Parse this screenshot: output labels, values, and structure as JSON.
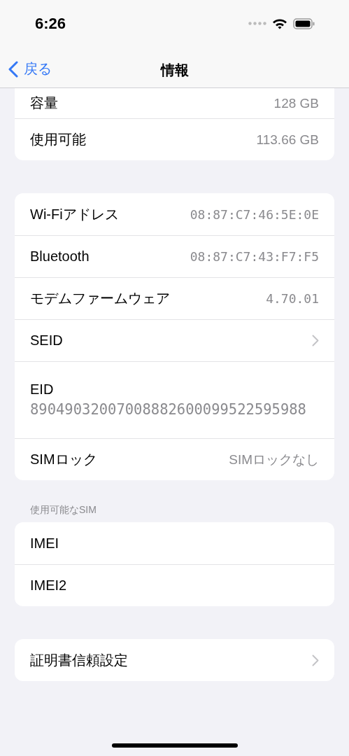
{
  "status_bar": {
    "time": "6:26"
  },
  "nav": {
    "back": "戻る",
    "title": "情報"
  },
  "groups": [
    {
      "clipped_top": true,
      "rows": [
        {
          "kind": "value",
          "label": "容量",
          "value": "128 GB",
          "mono": false
        },
        {
          "kind": "value",
          "label": "使用可能",
          "value": "113.66 GB",
          "mono": false
        }
      ]
    },
    {
      "clipped_top": false,
      "rows": [
        {
          "kind": "value",
          "label": "Wi-Fiアドレス",
          "value": "08:87:C7:46:5E:0E",
          "mono": true
        },
        {
          "kind": "value",
          "label": "Bluetooth",
          "value": "08:87:C7:43:F7:F5",
          "mono": true
        },
        {
          "kind": "value",
          "label": "モデムファームウェア",
          "value": "4.70.01",
          "mono": true
        },
        {
          "kind": "chevron",
          "label": "SEID"
        },
        {
          "kind": "stacked",
          "label": "EID",
          "value": "89049032007008882600099522595988",
          "mono": true
        },
        {
          "kind": "value",
          "label": "SIMロック",
          "value": "SIMロックなし",
          "mono": false
        }
      ]
    },
    {
      "clipped_top": false,
      "header": "使用可能なSIM",
      "rows": [
        {
          "kind": "label",
          "label": "IMEI"
        },
        {
          "kind": "label",
          "label": "IMEI2"
        }
      ]
    },
    {
      "clipped_top": false,
      "rows": [
        {
          "kind": "chevron",
          "label": "証明書信頼設定"
        }
      ]
    }
  ]
}
